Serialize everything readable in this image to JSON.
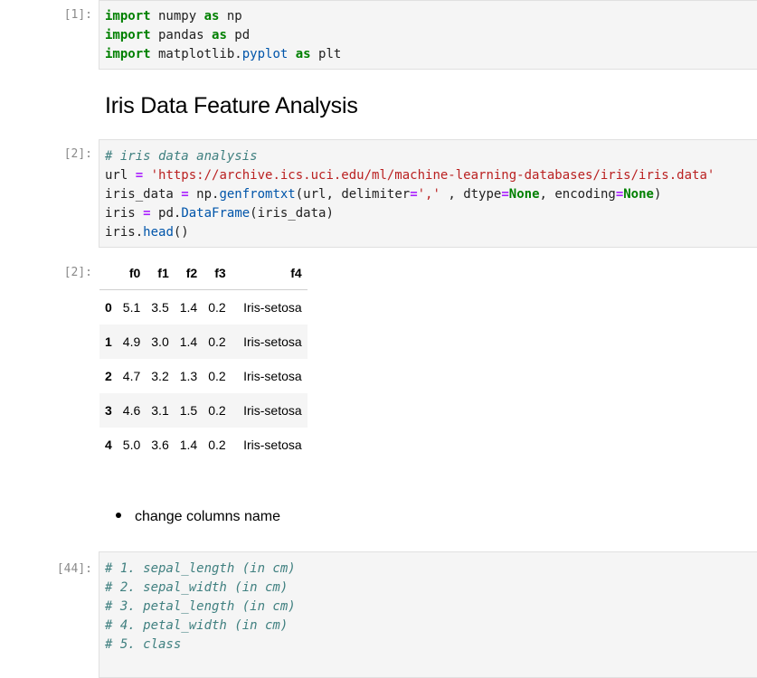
{
  "cells": {
    "c1": {
      "prompt": "[1]:",
      "lines": [
        {
          "kw": "import",
          "rest": " numpy ",
          "kw2": "as",
          "rest2": " np"
        },
        {
          "kw": "import",
          "rest": " pandas ",
          "kw2": "as",
          "rest2": " pd"
        },
        {
          "kw": "import",
          "rest": " matplotlib.",
          "attr": "pyplot",
          "rest1b": " ",
          "kw2": "as",
          "rest2": " plt"
        }
      ]
    },
    "heading": "Iris Data Feature Analysis",
    "c2": {
      "prompt": "[2]:",
      "comment": "# iris data analysis",
      "url_lhs": "url ",
      "url_eq": "=",
      "url_val": " 'https://archive.ics.uci.edu/ml/machine-learning-databases/iris/iris.data'",
      "gen_lhs": "iris_data ",
      "gen_eq": "=",
      "gen_a": " np.",
      "gen_fn": "genfromtxt",
      "gen_b": "(url, delimiter",
      "gen_eq2": "=",
      "gen_c": "',' ",
      "gen_d": ", dtype",
      "gen_eq3": "=",
      "gen_none1": "None",
      "gen_e": ", encoding",
      "gen_eq4": "=",
      "gen_none2": "None",
      "gen_f": ")",
      "df_lhs": "iris ",
      "df_eq": "=",
      "df_a": " pd.",
      "df_fn": "DataFrame",
      "df_b": "(iris_data)",
      "head_a": "iris.",
      "head_fn": "head",
      "head_b": "()"
    },
    "out2": {
      "prompt": "[2]:",
      "columns": [
        "",
        "f0",
        "f1",
        "f2",
        "f3",
        "f4"
      ],
      "rows": [
        [
          "0",
          "5.1",
          "3.5",
          "1.4",
          "0.2",
          "Iris-setosa"
        ],
        [
          "1",
          "4.9",
          "3.0",
          "1.4",
          "0.2",
          "Iris-setosa"
        ],
        [
          "2",
          "4.7",
          "3.2",
          "1.3",
          "0.2",
          "Iris-setosa"
        ],
        [
          "3",
          "4.6",
          "3.1",
          "1.5",
          "0.2",
          "Iris-setosa"
        ],
        [
          "4",
          "5.0",
          "3.6",
          "1.4",
          "0.2",
          "Iris-setosa"
        ]
      ]
    },
    "bullet": "change columns name",
    "c44": {
      "prompt": "[44]:",
      "comments": [
        "# 1. sepal_length (in cm)",
        "# 2. sepal_width (in cm)",
        "# 3. petal_length (in cm)",
        "# 4. petal_width (in cm)",
        "# 5. class"
      ]
    }
  }
}
